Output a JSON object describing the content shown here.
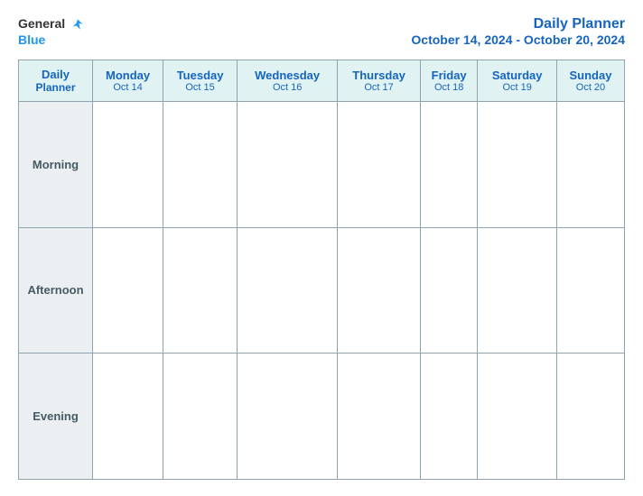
{
  "logo": {
    "text_general": "General",
    "text_blue": "Blue"
  },
  "header": {
    "title": "Daily Planner",
    "subtitle": "October 14, 2024 - October 20, 2024"
  },
  "table": {
    "label_header_line1": "Daily",
    "label_header_line2": "Planner",
    "columns": [
      {
        "day": "Monday",
        "date": "Oct 14"
      },
      {
        "day": "Tuesday",
        "date": "Oct 15"
      },
      {
        "day": "Wednesday",
        "date": "Oct 16"
      },
      {
        "day": "Thursday",
        "date": "Oct 17"
      },
      {
        "day": "Friday",
        "date": "Oct 18"
      },
      {
        "day": "Saturday",
        "date": "Oct 19"
      },
      {
        "day": "Sunday",
        "date": "Oct 20"
      }
    ],
    "rows": [
      {
        "label": "Morning"
      },
      {
        "label": "Afternoon"
      },
      {
        "label": "Evening"
      }
    ]
  }
}
